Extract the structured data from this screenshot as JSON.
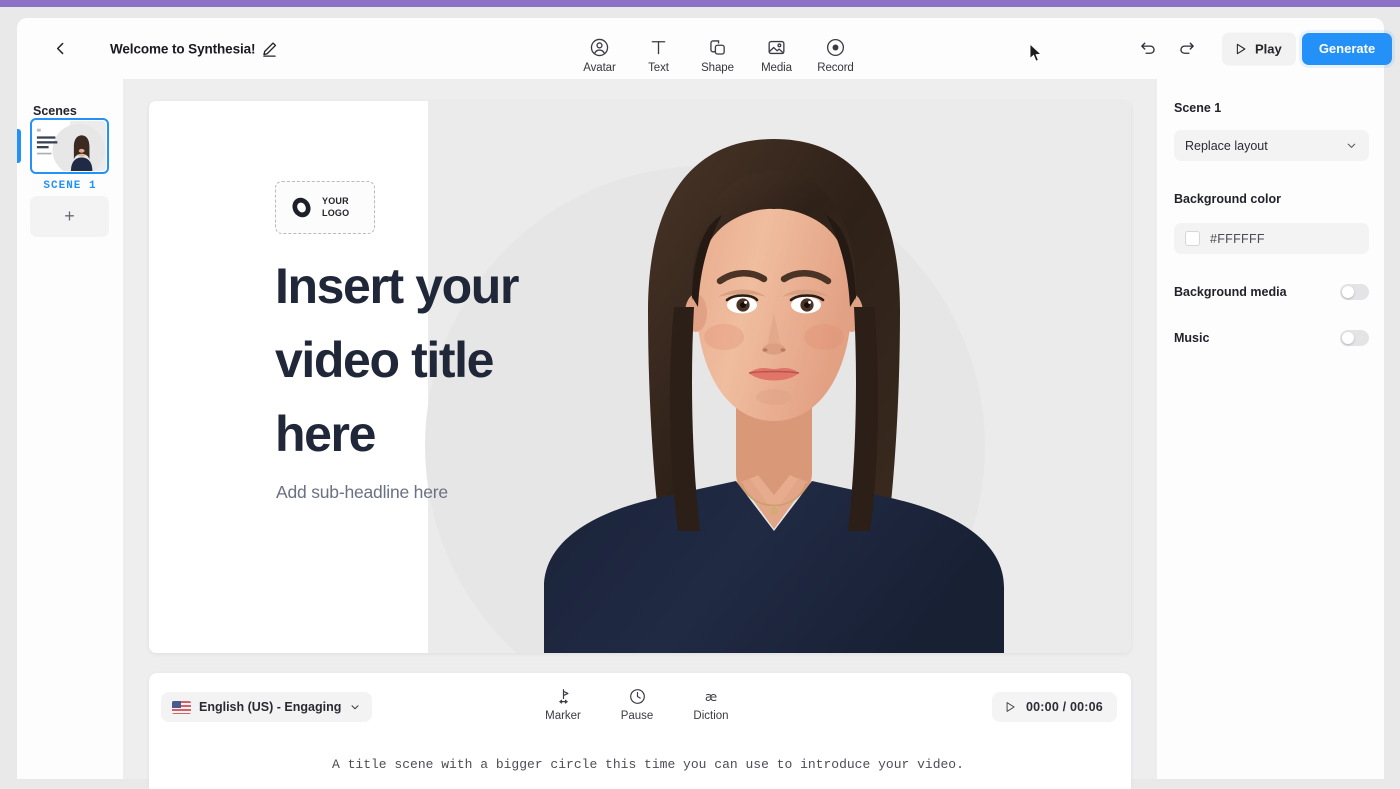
{
  "app": {
    "accent_purple": "#8B72C6",
    "accent_blue": "#2391F7"
  },
  "topbar": {
    "back_icon": "chevron-left-icon",
    "project_title": "Welcome to Synthesia!",
    "edit_icon": "pencil-icon",
    "tools": [
      {
        "label": "Avatar",
        "icon": "avatar-icon"
      },
      {
        "label": "Text",
        "icon": "text-icon"
      },
      {
        "label": "Shape",
        "icon": "shape-icon"
      },
      {
        "label": "Media",
        "icon": "media-icon"
      },
      {
        "label": "Record",
        "icon": "record-icon"
      }
    ],
    "undo_icon": "undo-icon",
    "redo_icon": "redo-icon",
    "play_label": "Play",
    "play_icon": "play-icon",
    "generate_label": "Generate"
  },
  "sidebar": {
    "title": "Scenes",
    "scene_label": "SCENE 1",
    "add_scene_label": "+"
  },
  "canvas": {
    "logo_text_line1": "YOUR",
    "logo_text_line2": "LOGO",
    "title": "Insert your video title here",
    "subtitle": "Add sub-headline here",
    "avatar_alt": "presenter-avatar"
  },
  "rightpanel": {
    "scene_title": "Scene 1",
    "layout_select_value": "Replace layout",
    "background_color_label": "Background color",
    "background_color_value": "#FFFFFF",
    "background_media_label": "Background media",
    "background_media_on": false,
    "music_label": "Music",
    "music_on": false
  },
  "scriptpanel": {
    "language": "English (US) - Engaging",
    "tools": [
      {
        "label": "Marker",
        "icon": "marker-icon"
      },
      {
        "label": "Pause",
        "icon": "clock-icon"
      },
      {
        "label": "Diction",
        "icon": "diction-icon"
      }
    ],
    "time_current": "00:00",
    "time_total": "00:06",
    "time_display": "00:00 / 00:06",
    "script": "A title scene with a bigger circle this time you can use to introduce your video."
  }
}
